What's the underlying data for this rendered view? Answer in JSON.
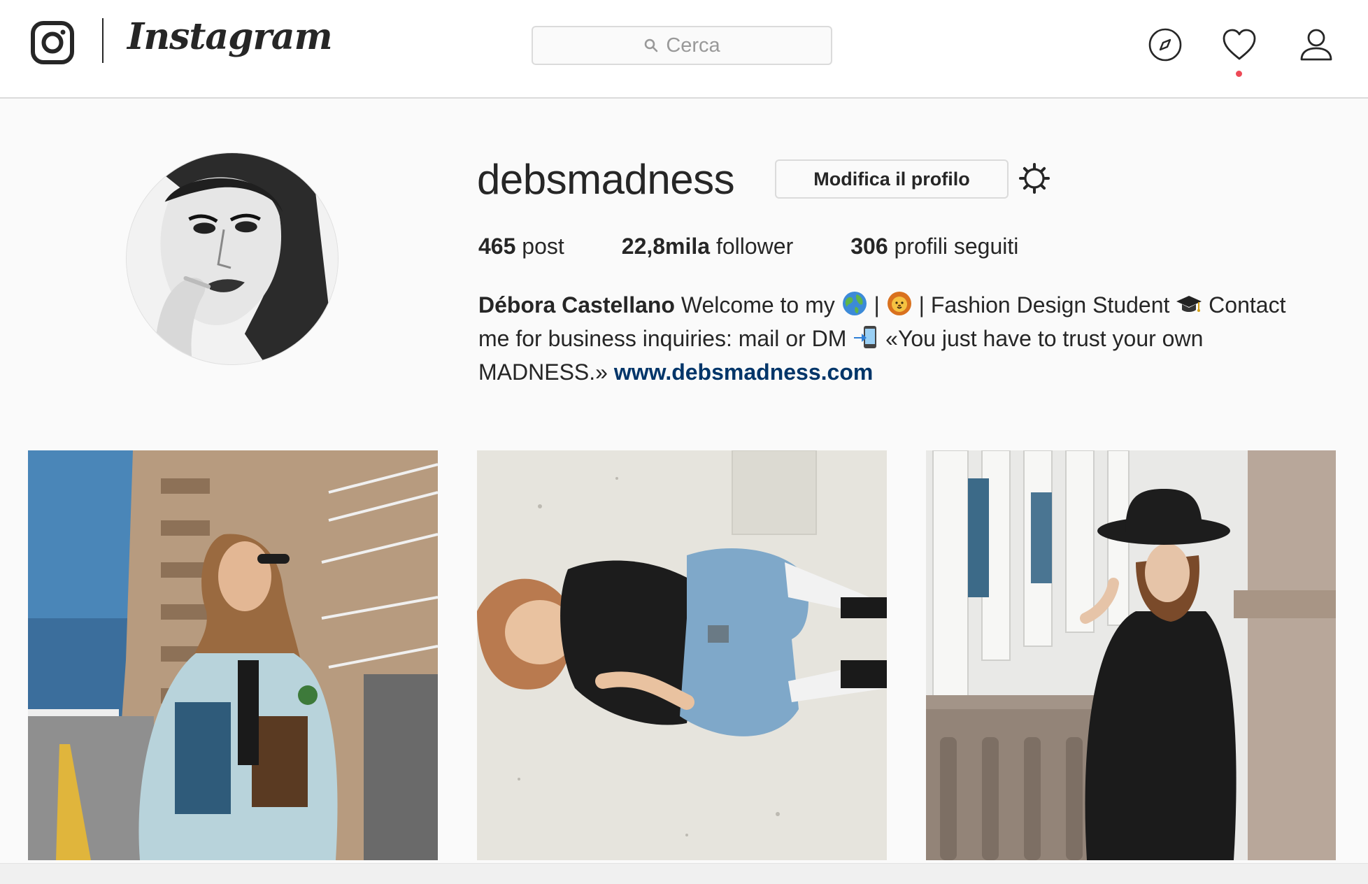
{
  "app": {
    "name": "Instagram"
  },
  "search": {
    "placeholder": "Cerca"
  },
  "profile": {
    "username": "debsmadness",
    "edit_label": "Modifica il profilo",
    "stats": [
      {
        "count": "465",
        "label": "post"
      },
      {
        "count": "22,8mila",
        "label": "follower"
      },
      {
        "count": "306",
        "label": "profili seguiti"
      }
    ],
    "bio": {
      "full_name": "Débora Castellano",
      "part1": " Welcome to my ",
      "part2": " | ",
      "part3": " | Fashion Design Student ",
      "part4": " Contact me for business inquiries: mail or DM ",
      "part5": " «You just have to trust your own MADNESS.» ",
      "website": "www.debsmadness.com",
      "emojis": [
        "globe-icon",
        "lion-icon",
        "graduation-cap-icon",
        "phone-arrow-icon"
      ]
    }
  },
  "nav": {
    "icons": [
      "explore-icon",
      "activity-heart-icon",
      "profile-icon"
    ]
  },
  "posts": [
    {
      "description": "denim-jacket-street-photo"
    },
    {
      "description": "lying-on-floor-photo"
    },
    {
      "description": "black-hat-balcony-photo"
    }
  ],
  "colors": {
    "link": "#003569",
    "notification": "#ed4956",
    "border": "#dbdbdb",
    "background": "#fafafa"
  }
}
